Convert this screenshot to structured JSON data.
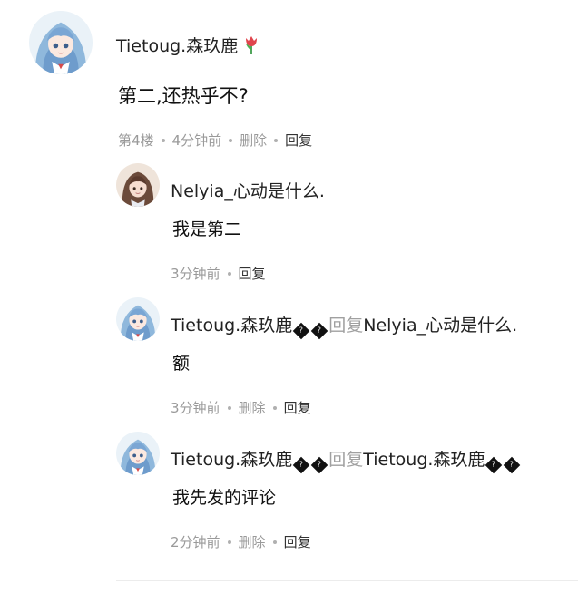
{
  "main_comment": {
    "author": "Tietoug.森玖鹿",
    "content": "第二,还热乎不?",
    "floor": "第4楼",
    "time": "4分钟前",
    "delete_label": "删除",
    "reply_label": "回复"
  },
  "replies": [
    {
      "author": "Nelyia_心动是什么.",
      "content": "我是第二",
      "time": "3分钟前",
      "reply_label": "回复"
    },
    {
      "author": "Tietoug.森玖鹿",
      "reply_word": "回复",
      "target": "Nelyia_心动是什么.",
      "content": "额",
      "time": "3分钟前",
      "delete_label": "删除",
      "reply_label": "回复"
    },
    {
      "author": "Tietoug.森玖鹿",
      "reply_word": "回复",
      "target": "Tietoug.森玖鹿",
      "content": "我先发的评论",
      "time": "2分钟前",
      "delete_label": "删除",
      "reply_label": "回复"
    }
  ],
  "icons": {
    "flower": "tulip-icon",
    "broken_glyph": "replacement-char-icon"
  },
  "colors": {
    "meta_text": "#9a9a9a",
    "tulip": "#e0454d"
  }
}
